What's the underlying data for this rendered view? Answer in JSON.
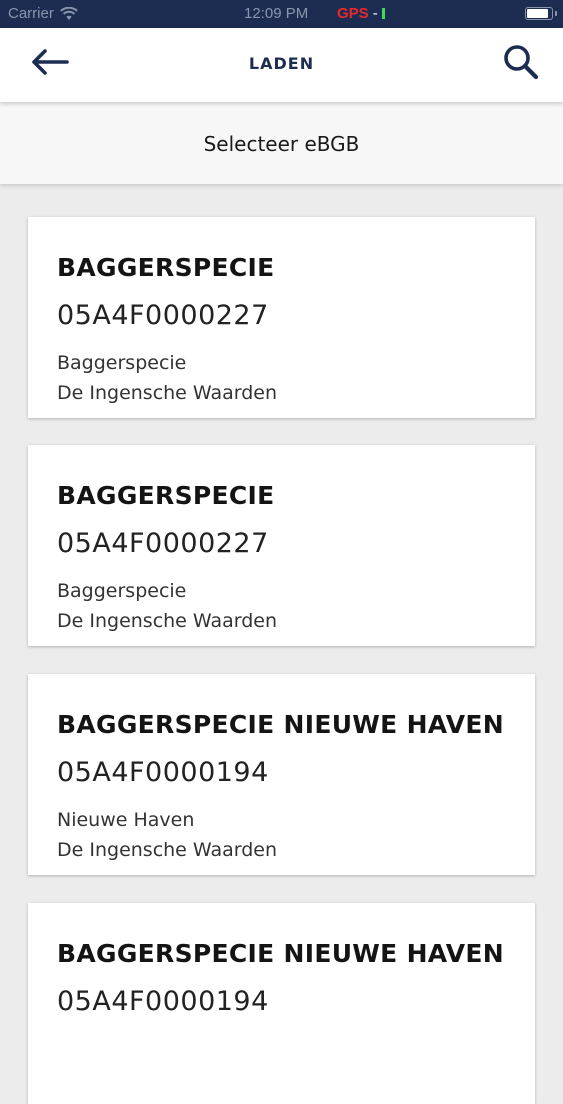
{
  "status_bar": {
    "carrier": "Carrier",
    "wifi_icon": "wifi-icon",
    "time": "12:09 PM",
    "gps_label": "GPS",
    "gps_separator": "-",
    "battery_level": 0.9
  },
  "header": {
    "back_icon": "arrow-left-icon",
    "title": "LADEN",
    "search_icon": "search-icon"
  },
  "subheader": {
    "title": "Selecteer eBGB"
  },
  "colors": {
    "status_bar_bg": "#1d2d52",
    "accent_navy": "#1d2d52",
    "gps_red": "#e8282e",
    "gps_green": "#3fdc5a",
    "page_bg": "#ececec",
    "card_bg": "#ffffff"
  },
  "items": [
    {
      "name": "BAGGERSPECIE",
      "code": "05A4F0000227",
      "line1": "Baggerspecie",
      "line2": "De Ingensche Waarden"
    },
    {
      "name": "BAGGERSPECIE",
      "code": "05A4F0000227",
      "line1": "Baggerspecie",
      "line2": "De Ingensche Waarden"
    },
    {
      "name": "BAGGERSPECIE NIEUWE HAVEN",
      "code": "05A4F0000194",
      "line1": "Nieuwe Haven",
      "line2": "De Ingensche Waarden"
    },
    {
      "name": "BAGGERSPECIE NIEUWE HAVEN",
      "code": "05A4F0000194",
      "line1": "",
      "line2": ""
    }
  ]
}
